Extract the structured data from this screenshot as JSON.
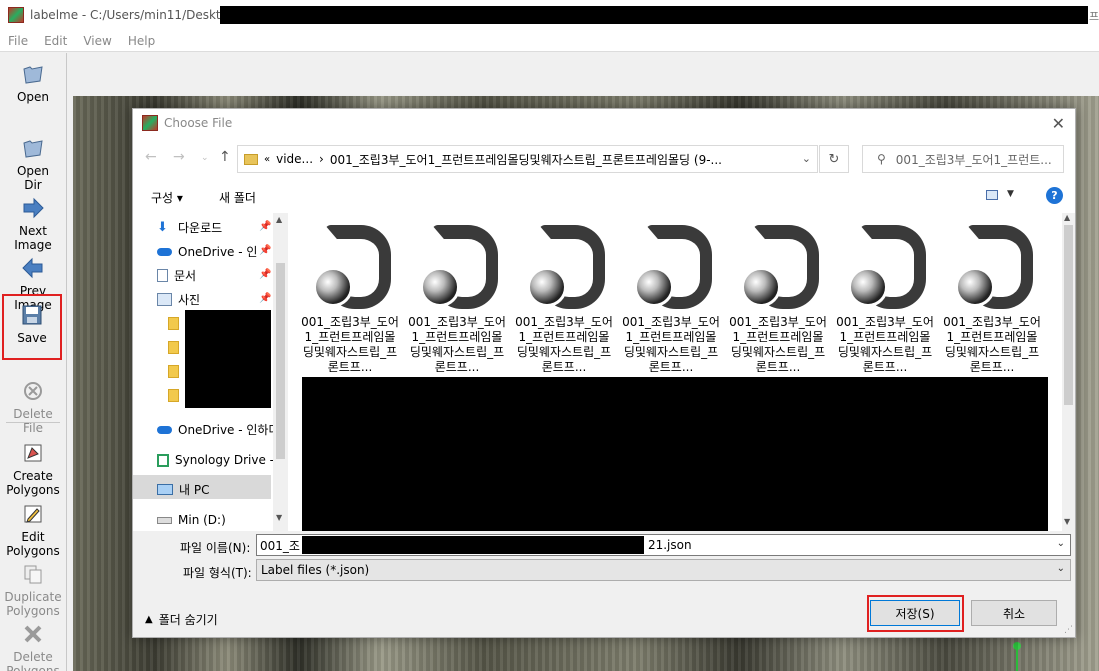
{
  "window": {
    "title": "labelme - C:/Users/min11/Desktop/",
    "title_tail": "프"
  },
  "menu": [
    "File",
    "Edit",
    "View",
    "Help"
  ],
  "toolbar": {
    "open": "Open",
    "open_dir": "Open\nDir",
    "next_image": "Next\nImage",
    "prev_image": "Prev\nImage",
    "save": "Save",
    "delete_file": "Delete\nFile",
    "create_polygons": "Create\nPolygons",
    "edit_polygons": "Edit\nPolygons",
    "duplicate_polygons": "Duplicate\nPolygons",
    "delete_polygons": "Delete\nPolygons"
  },
  "dialog": {
    "title": "Choose File",
    "address": {
      "prefix": "«",
      "crumb1": "vide...",
      "sep": "›",
      "crumb2": "001_조립3부_도어1_프런트프레임몰딩및웨자스트립_프론트프레임몰딩 (9-..."
    },
    "search_placeholder": "001_조립3부_도어1_프런트...",
    "commands": {
      "organize": "구성 ▾",
      "new_folder": "새 폴더"
    },
    "help": "?",
    "nav": [
      {
        "label": "다운로드",
        "pinned": true
      },
      {
        "label": "OneDrive - 인",
        "pinned": true
      },
      {
        "label": "문서",
        "pinned": true
      },
      {
        "label": "사진",
        "pinned": true
      },
      {
        "label": "OneDrive - 인하다",
        "pinned": false
      },
      {
        "label": "Synology Drive -",
        "pinned": false
      },
      {
        "label": "내 PC",
        "pinned": false
      },
      {
        "label": "Min (D:)",
        "pinned": false
      }
    ],
    "files": [
      "001_조립3부_도어1_프런트프레임몰딩및웨자스트립_프론트프...",
      "001_조립3부_도어1_프런트프레임몰딩및웨자스트립_프론트프...",
      "001_조립3부_도어1_프런트프레임몰딩및웨자스트립_프론트프...",
      "001_조립3부_도어1_프런트프레임몰딩및웨자스트립_프론트프...",
      "001_조립3부_도어1_프런트프레임몰딩및웨자스트립_프론트프...",
      "001_조립3부_도어1_프런트프레임몰딩및웨자스트립_프론트프...",
      "001_조립3부_도어1_프런트프레임몰딩및웨자스트립_프론트프..."
    ],
    "filename_label": "파일 이름(N):",
    "filename_value_start": "001_조",
    "filename_value_end": "21.json",
    "filetype_label": "파일 형식(T):",
    "filetype_value": "Label files (*.json)",
    "hide_folders": "폴더 숨기기",
    "save_button": "저장(S)",
    "cancel_button": "취소"
  }
}
